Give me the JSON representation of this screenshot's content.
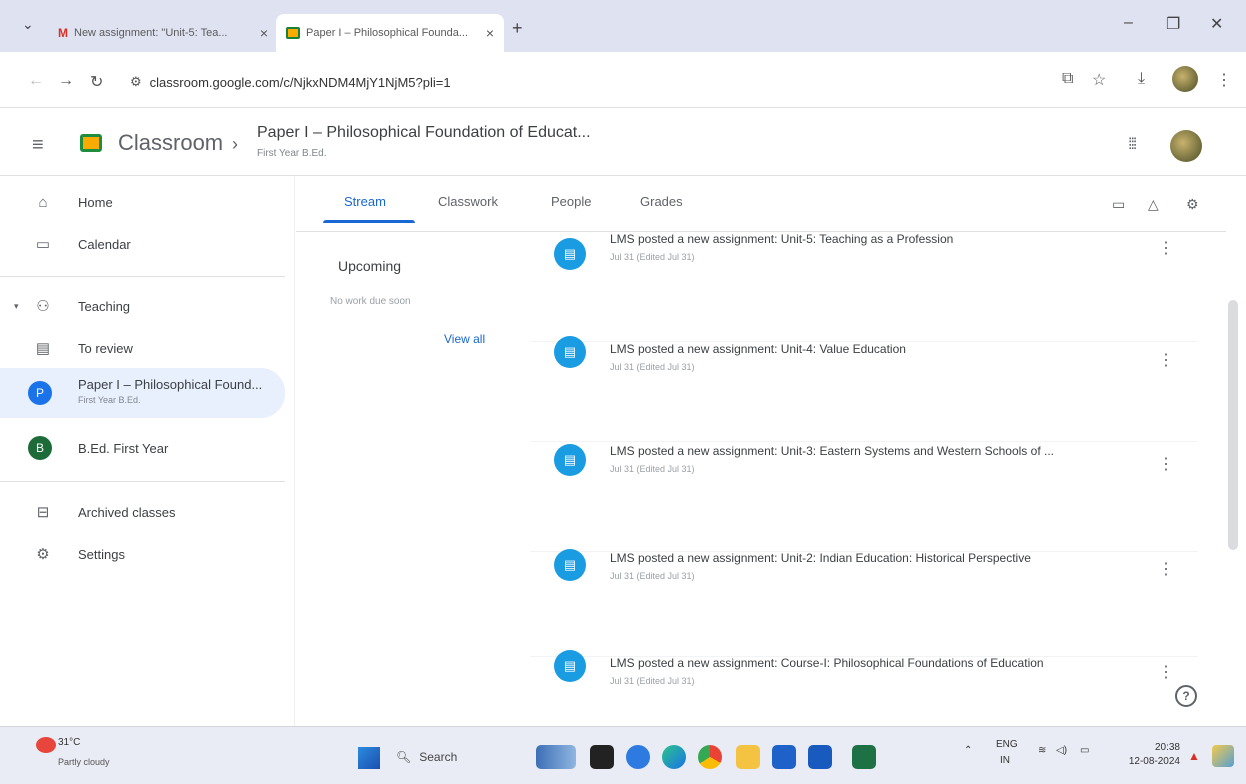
{
  "browser": {
    "tabs": [
      {
        "title": "New assignment: \"Unit-5: Tea..."
      },
      {
        "title": "Paper I – Philosophical Founda..."
      }
    ],
    "url": "classroom.google.com/c/NjkxNDM4MjY1NjM5?pli=1"
  },
  "header": {
    "brand": "Classroom",
    "course_title": "Paper I – Philosophical Foundation of Educat...",
    "course_sub": "First Year B.Ed."
  },
  "sidebar": {
    "home": "Home",
    "calendar": "Calendar",
    "teaching": "Teaching",
    "to_review": "To review",
    "classes": [
      {
        "initial": "P",
        "name": "Paper I – Philosophical Found...",
        "sub": "First Year B.Ed."
      },
      {
        "initial": "B",
        "name": "B.Ed. First Year",
        "sub": ""
      }
    ],
    "archived": "Archived classes",
    "settings": "Settings"
  },
  "tabs": {
    "stream": "Stream",
    "classwork": "Classwork",
    "people": "People",
    "grades": "Grades"
  },
  "upcoming": {
    "title": "Upcoming",
    "none": "No work due soon",
    "view_all": "View all"
  },
  "posts": [
    {
      "title": "LMS posted a new assignment: Unit-5: Teaching as a Profession",
      "date": "Jul 31 (Edited Jul 31)"
    },
    {
      "title": "LMS posted a new assignment: Unit-4: Value Education",
      "date": "Jul 31 (Edited Jul 31)"
    },
    {
      "title": "LMS posted a new assignment: Unit-3: Eastern Systems and Western Schools of ...",
      "date": "Jul 31 (Edited Jul 31)"
    },
    {
      "title": "LMS posted a new assignment: Unit-2: Indian Education: Historical Perspective",
      "date": "Jul 31 (Edited Jul 31)"
    },
    {
      "title": "LMS posted a new assignment: Course-I: Philosophical Foundations of Education",
      "date": "Jul 31 (Edited Jul 31)"
    }
  ],
  "taskbar": {
    "temp": "31°C",
    "weather": "Partly cloudy",
    "search": "Search",
    "lang1": "ENG",
    "lang2": "IN",
    "time": "20:38",
    "date": "12-08-2024"
  },
  "colors": {
    "accent": "#1967d2",
    "post_icon": "#1a9ce3",
    "selected_bg": "#e8f0fe"
  }
}
